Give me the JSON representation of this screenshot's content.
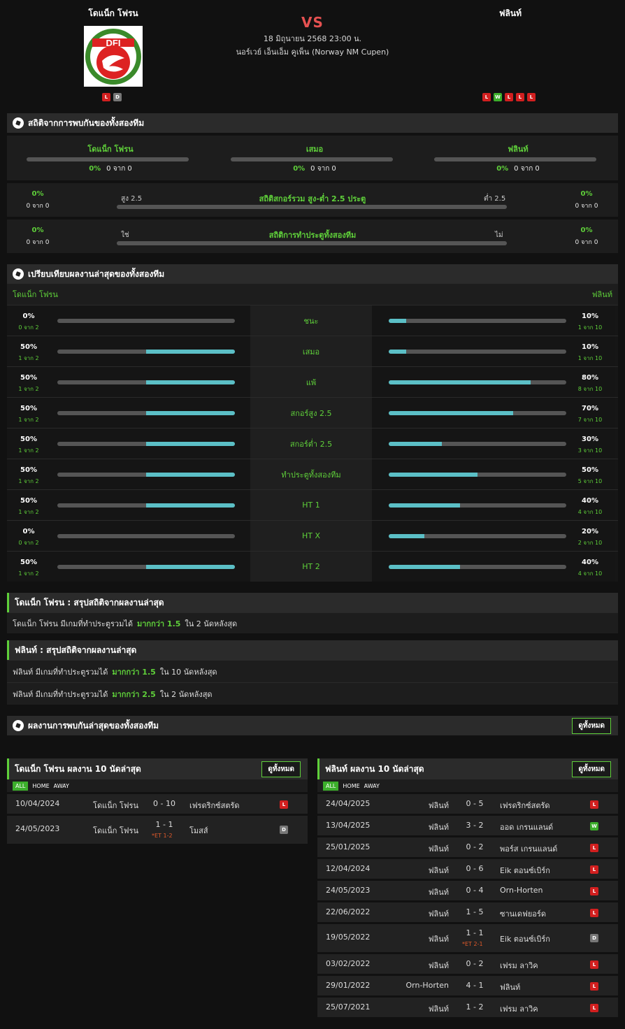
{
  "match": {
    "home": "โดแน็ก โฟรน",
    "away": "ฟลินท์",
    "vs": "VS",
    "date": "18 มิถุนายน 2568 23:00 น.",
    "competition": "นอร์เวย์ เอ็นเอ็ม คูเพ็น (Norway NM Cupen)",
    "home_form": [
      "L",
      "D"
    ],
    "away_form": [
      "L",
      "W",
      "L",
      "L",
      "L"
    ],
    "home_logo_text": "DFI"
  },
  "h2h": {
    "title": "สถิติจากการพบกันของทั้งสองทีม",
    "cols": [
      {
        "label": "โดแน็ก โฟรน",
        "pct": "0%",
        "count": "0 จาก 0"
      },
      {
        "label": "เสมอ",
        "pct": "0%",
        "count": "0 จาก 0"
      },
      {
        "label": "ฟลินท์",
        "pct": "0%",
        "count": "0 จาก 0"
      }
    ],
    "ou": {
      "title": "สถิติสกอร์รวม สูง-ต่ำ 2.5 ประตู",
      "left_label": "สูง 2.5",
      "right_label": "ต่ำ 2.5",
      "left_pct": "0%",
      "left_count": "0 จาก 0",
      "right_pct": "0%",
      "right_count": "0 จาก 0"
    },
    "btts": {
      "title": "สถิติการทำประตูทั้งสองทีม",
      "left_label": "ใช่",
      "right_label": "ไม่",
      "left_pct": "0%",
      "left_count": "0 จาก 0",
      "right_pct": "0%",
      "right_count": "0 จาก 0"
    }
  },
  "compare": {
    "title": "เปรียบเทียบผลงานล่าสุดของทั้งสองทีม",
    "home": "โดแน็ก โฟรน",
    "away": "ฟลินท์",
    "rows": [
      {
        "label": "ชนะ",
        "lp": "0%",
        "lc": "0 จาก 2",
        "lv": 0,
        "rp": "10%",
        "rc": "1 จาก 10",
        "rv": 10
      },
      {
        "label": "เสมอ",
        "lp": "50%",
        "lc": "1 จาก 2",
        "lv": 50,
        "rp": "10%",
        "rc": "1 จาก 10",
        "rv": 10
      },
      {
        "label": "แพ้",
        "lp": "50%",
        "lc": "1 จาก 2",
        "lv": 50,
        "rp": "80%",
        "rc": "8 จาก 10",
        "rv": 80
      },
      {
        "label": "สกอร์สูง 2.5",
        "lp": "50%",
        "lc": "1 จาก 2",
        "lv": 50,
        "rp": "70%",
        "rc": "7 จาก 10",
        "rv": 70
      },
      {
        "label": "สกอร์ต่ำ 2.5",
        "lp": "50%",
        "lc": "1 จาก 2",
        "lv": 50,
        "rp": "30%",
        "rc": "3 จาก 10",
        "rv": 30
      },
      {
        "label": "ทำประตูทั้งสองทีม",
        "lp": "50%",
        "lc": "1 จาก 2",
        "lv": 50,
        "rp": "50%",
        "rc": "5 จาก 10",
        "rv": 50
      },
      {
        "label": "HT 1",
        "lp": "50%",
        "lc": "1 จาก 2",
        "lv": 50,
        "rp": "40%",
        "rc": "4 จาก 10",
        "rv": 40
      },
      {
        "label": "HT X",
        "lp": "0%",
        "lc": "0 จาก 2",
        "lv": 0,
        "rp": "20%",
        "rc": "2 จาก 10",
        "rv": 20
      },
      {
        "label": "HT 2",
        "lp": "50%",
        "lc": "1 จาก 2",
        "lv": 50,
        "rp": "40%",
        "rc": "4 จาก 10",
        "rv": 40
      }
    ]
  },
  "summary_home": {
    "title": "โดแน็ก โฟรน : สรุปสถิติจากผลงานล่าสุด",
    "lines": [
      {
        "pre": "โดแน็ก โฟรน  มีเกมที่ทำประตูรวมได้",
        "hl": "มากกว่า  1.5",
        "post": "ใน 2 นัดหลังสุด"
      }
    ]
  },
  "summary_away": {
    "title": "ฟลินท์ : สรุปสถิติจากผลงานล่าสุด",
    "lines": [
      {
        "pre": "ฟลินท์  มีเกมที่ทำประตูรวมได้",
        "hl": "มากกว่า  1.5",
        "post": "ใน 10 นัดหลังสุด"
      },
      {
        "pre": "ฟลินท์  มีเกมที่ทำประตูรวมได้",
        "hl": "มากกว่า  2.5",
        "post": "ใน 2 นัดหลังสุด"
      }
    ]
  },
  "h2h_results": {
    "title": "ผลงานการพบกันล่าสุดของทั้งสองทีม",
    "view_all": "ดูทั้งหมด"
  },
  "tabs": [
    "ALL",
    "HOME",
    "AWAY"
  ],
  "recent_home": {
    "title": "โดแน็ก โฟรน ผลงาน 10 นัดล่าสุด",
    "view_all": "ดูทั้งหมด",
    "rows": [
      {
        "date": "10/04/2024",
        "home": "โดแน็ก โฟรน",
        "score": "0 - 10",
        "away": "เฟรดริกซ์สตรัด",
        "res": "L",
        "et": ""
      },
      {
        "date": "24/05/2023",
        "home": "โดแน็ก โฟรน",
        "score": "1 - 1",
        "away": "โมสส์",
        "res": "D",
        "et": "*ET 1-2"
      }
    ]
  },
  "recent_away": {
    "title": "ฟลินท์ ผลงาน 10 นัดล่าสุด",
    "view_all": "ดูทั้งหมด",
    "rows": [
      {
        "date": "24/04/2025",
        "home": "ฟลินท์",
        "score": "0 - 5",
        "away": "เฟรดริกซ์สตรัด",
        "res": "L",
        "et": ""
      },
      {
        "date": "13/04/2025",
        "home": "ฟลินท์",
        "score": "3 - 2",
        "away": "ออด เกรนแลนด์",
        "res": "W",
        "et": ""
      },
      {
        "date": "25/01/2025",
        "home": "ฟลินท์",
        "score": "0 - 2",
        "away": "พอร์ส เกรนแลนด์",
        "res": "L",
        "et": ""
      },
      {
        "date": "12/04/2024",
        "home": "ฟลินท์",
        "score": "0 - 6",
        "away": "Eik ตอนซ์เบิร์ก",
        "res": "L",
        "et": ""
      },
      {
        "date": "24/05/2023",
        "home": "ฟลินท์",
        "score": "0 - 4",
        "away": "Orn-Horten",
        "res": "L",
        "et": ""
      },
      {
        "date": "22/06/2022",
        "home": "ฟลินท์",
        "score": "1 - 5",
        "away": "ซานเดฟยอร์ด",
        "res": "L",
        "et": ""
      },
      {
        "date": "19/05/2022",
        "home": "ฟลินท์",
        "score": "1 - 1",
        "away": "Eik ตอนซ์เบิร์ก",
        "res": "D",
        "et": "*ET 2-1"
      },
      {
        "date": "03/02/2022",
        "home": "ฟลินท์",
        "score": "0 - 2",
        "away": "เฟรม ลาวิค",
        "res": "L",
        "et": ""
      },
      {
        "date": "29/01/2022",
        "home": "Orn-Horten",
        "score": "4 - 1",
        "away": "ฟลินท์",
        "res": "L",
        "et": ""
      },
      {
        "date": "25/07/2021",
        "home": "ฟลินท์",
        "score": "1 - 2",
        "away": "เฟรม ลาวิค",
        "res": "L",
        "et": ""
      }
    ]
  }
}
